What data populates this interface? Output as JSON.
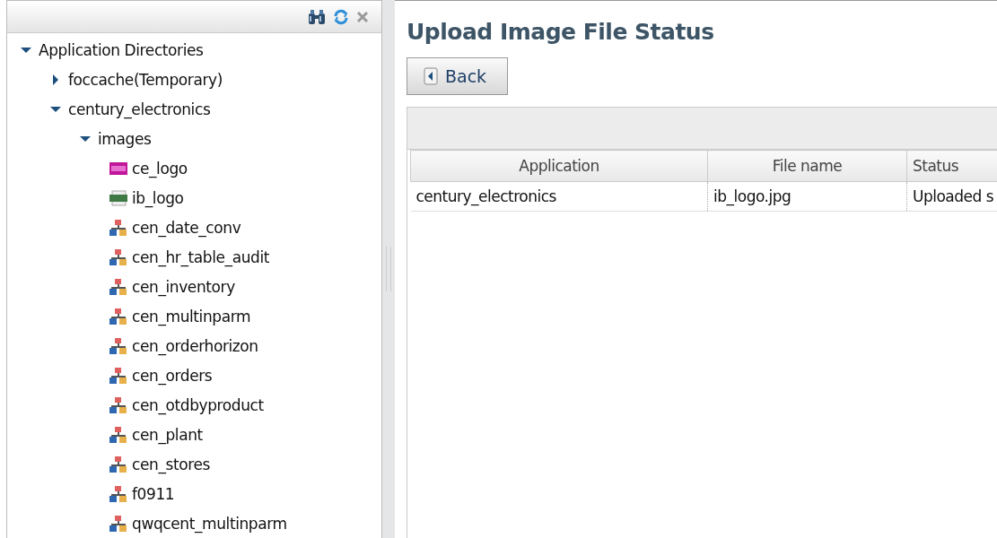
{
  "tree": [
    {
      "label": "Application Directories",
      "expanded": true,
      "children": [
        {
          "label": "foccache(Temporary)",
          "expanded": false
        },
        {
          "label": "century_electronics",
          "expanded": true,
          "children": [
            {
              "label": "images",
              "expanded": true,
              "children": [
                {
                  "label": "ce_logo",
                  "kind": "gif"
                },
                {
                  "label": "ib_logo",
                  "kind": "jpeg"
                },
                {
                  "label": "cen_date_conv",
                  "kind": "procedure"
                },
                {
                  "label": "cen_hr_table_audit",
                  "kind": "procedure"
                },
                {
                  "label": "cen_inventory",
                  "kind": "procedure"
                },
                {
                  "label": "cen_multinparm",
                  "kind": "procedure"
                },
                {
                  "label": "cen_orderhorizon",
                  "kind": "procedure"
                },
                {
                  "label": "cen_orders",
                  "kind": "procedure"
                },
                {
                  "label": "cen_otdbyproduct",
                  "kind": "procedure"
                },
                {
                  "label": "cen_plant",
                  "kind": "procedure"
                },
                {
                  "label": "cen_stores",
                  "kind": "procedure"
                },
                {
                  "label": "f0911",
                  "kind": "procedure"
                },
                {
                  "label": "qwqcent_multinparm",
                  "kind": "procedure"
                }
              ]
            }
          ]
        }
      ]
    }
  ],
  "page": {
    "title": "Upload Image File Status",
    "back_button": "Back"
  },
  "table": {
    "columns": [
      "Application",
      "File name",
      "Status"
    ],
    "rows": [
      [
        "century_electronics",
        "ib_logo.jpg",
        "Uploaded s"
      ]
    ]
  }
}
